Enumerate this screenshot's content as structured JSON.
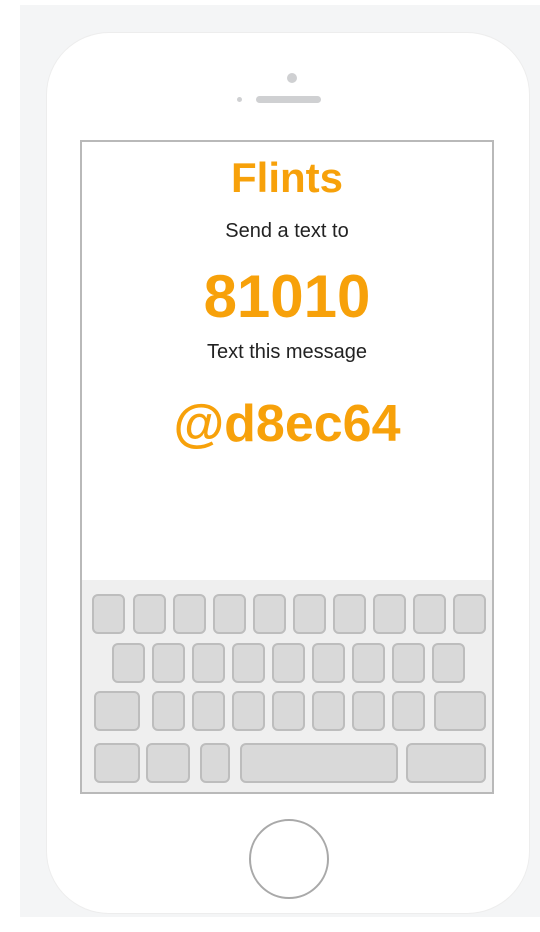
{
  "screen": {
    "title": "Flints",
    "instruction_1": "Send a text to",
    "phone_number": "81010",
    "instruction_2": "Text this message",
    "message_code": "@d8ec64"
  },
  "colors": {
    "accent": "#f7a10a",
    "text": "#222222",
    "key_fill": "#d9d9d9",
    "key_border": "#bdbdbd"
  },
  "device": {
    "keyboard_rows": 4
  }
}
